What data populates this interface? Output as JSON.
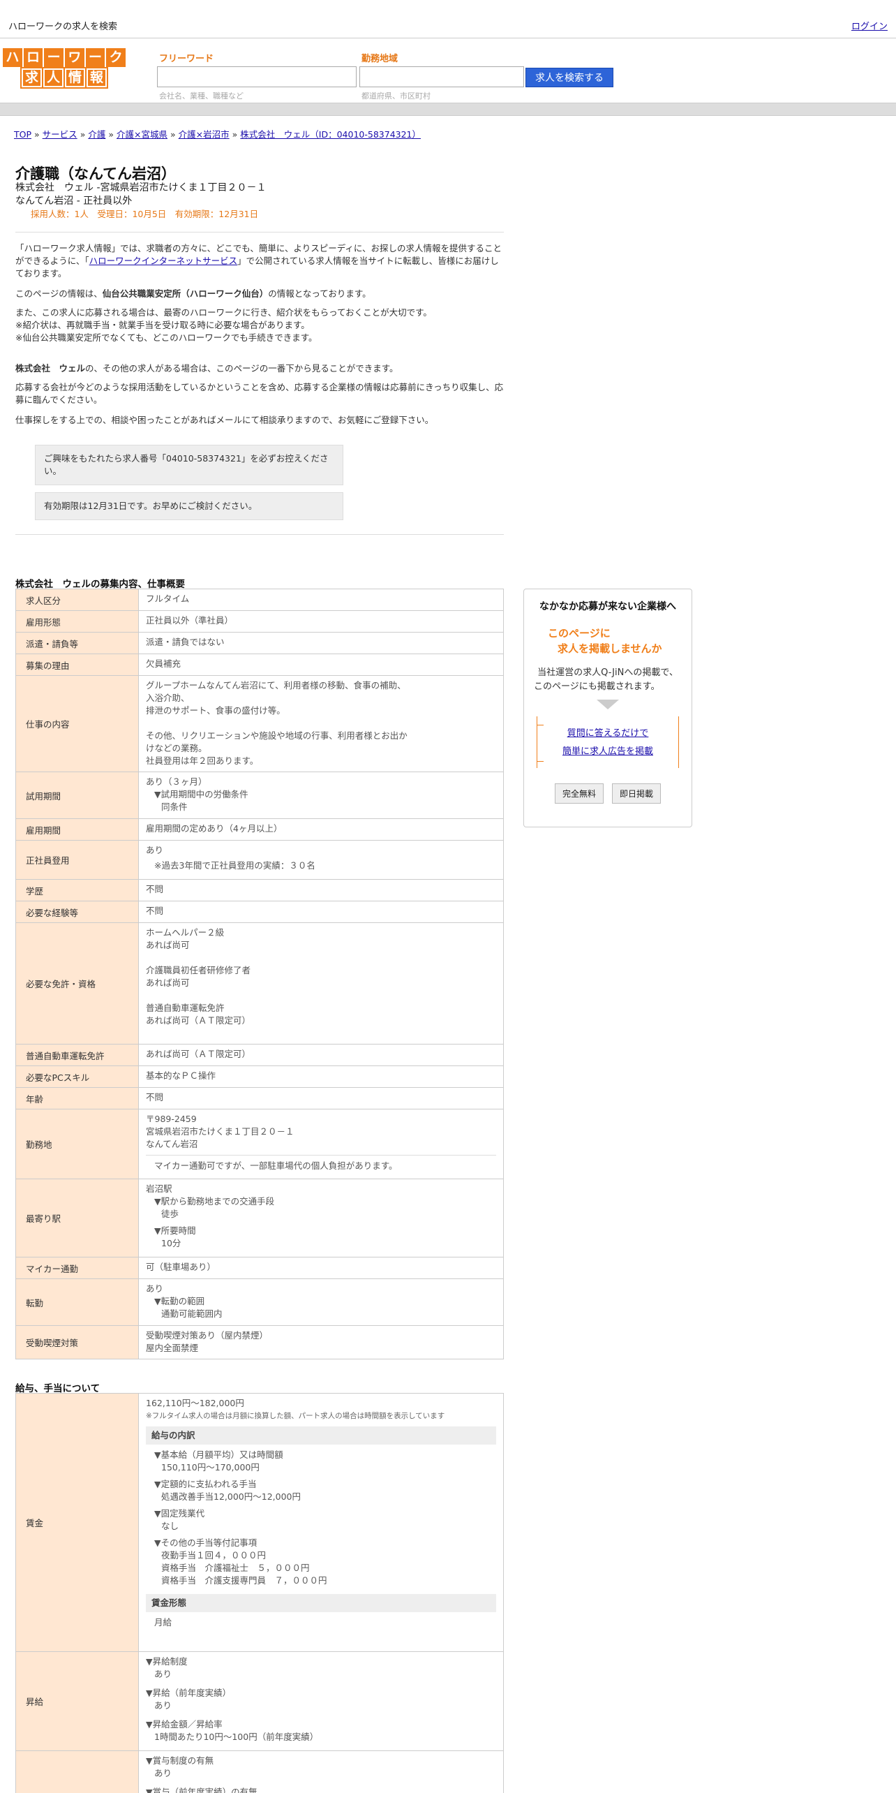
{
  "topbar": {
    "title": "ハローワークの求人を検索",
    "login": "ログイン"
  },
  "logo": {
    "row1": [
      "ハ",
      "ロ",
      "ー",
      "ワ",
      "ー",
      "ク"
    ],
    "row2": [
      "求",
      "人",
      "情",
      "報"
    ]
  },
  "search": {
    "free_label": "フリーワード",
    "free_hint": "会社名、業種、職種など",
    "area_label": "勤務地域",
    "area_hint": "都道府県、市区町村",
    "button": "求人を検索する"
  },
  "breadcrumb": [
    "TOP",
    "サービス",
    "介護",
    "介護×宮城県",
    "介護×岩沼市",
    "株式会社　ウェル（ID：04010-58374321）"
  ],
  "job": {
    "title": "介護職（なんてん岩沼）",
    "company_line": "株式会社　ウェル -宮城県岩沼市たけくま１丁目２０－１",
    "place_line": "なんてん岩沼 - 正社員以外",
    "meta": "採用人数：1人　受理日：10月5日　有効期限：12月31日"
  },
  "intro": {
    "p1a": "「ハローワーク求人情報」では、求職者の方々に、どこでも、簡単に、よりスピーディに、お探しの求人情報を提供することができるように、「",
    "p1link": "ハローワークインターネットサービス",
    "p1b": "」で公開されている求人情報を当サイトに転載し、皆様にお届けしております。",
    "p2a": "このページの情報は、",
    "p2b": "仙台公共職業安定所（ハローワーク仙台）",
    "p2c": "の情報となっております。",
    "p3": [
      "また、この求人に応募される場合は、最寄のハローワークに行き、紹介状をもらっておくことが大切です。",
      "※紹介状は、再就職手当・就業手当を受け取る時に必要な場合があります。",
      "※仙台公共職業安定所でなくても、どこのハローワークでも手続きできます。"
    ],
    "p4a": "株式会社　ウェル",
    "p4b": "の、その他の求人がある場合は、このページの一番下から見ることができます。",
    "p5": "応募する会社が今どのような採用活動をしているかということを含め、応募する企業様の情報は応募前にきっちり収集し、応募に臨んでください。",
    "p6": "仕事探しをする上での、相談や困ったことがあればメールにて相談承りますので、お気軽にご登録下さい。",
    "notice1": "ご興味をもたれたら求人番号「04010-58374321」を必ずお控えください。",
    "notice2": "有効期限は12月31日です。お早めにご検討ください。"
  },
  "section1_title": "株式会社　ウェルの募集内容、仕事概要",
  "rows": {
    "kubun": [
      "求人区分",
      "フルタイム"
    ],
    "koyo": [
      "雇用形態",
      "正社員以外（準社員）"
    ],
    "haken": [
      "派遣・請負等",
      "派遣・請負ではない"
    ],
    "riyu": [
      "募集の理由",
      "欠員補充"
    ],
    "naiyo": [
      "仕事の内容",
      "グループホームなんてん岩沼にて、利用者様の移動、食事の補助、",
      "入浴介助、",
      "排泄のサポート、食事の盛付け等。",
      "その他、リクリエーションや施設や地域の行事、利用者様とお出か",
      "けなどの業務。",
      "社員登用は年２回あります。"
    ],
    "shiyo": [
      "試用期間",
      "あり（３ヶ月）",
      "▼試用期間中の労働条件",
      "同条件"
    ],
    "koyokikan": [
      "雇用期間",
      "雇用期間の定めあり（4ヶ月以上）"
    ],
    "seishain": [
      "正社員登用",
      "あり",
      "※過去3年間で正社員登用の実績：３０名"
    ],
    "gakureki": [
      "学歴",
      "不問"
    ],
    "keiken": [
      "必要な経験等",
      "不問"
    ],
    "menkyo": [
      "必要な免許・資格",
      "ホームヘルパー２級",
      "あれば尚可",
      "介護職員初任者研修修了者",
      "あれば尚可",
      "普通自動車運転免許",
      "あれば尚可（ＡＴ限定可）"
    ],
    "futsu": [
      "普通自動車運転免許",
      "あれば尚可（ＡＴ限定可）"
    ],
    "pc": [
      "必要なPCスキル",
      "基本的なＰＣ操作"
    ],
    "nenrei": [
      "年齢",
      "不問"
    ],
    "kinmuchi": [
      "勤務地",
      "〒989-2459",
      "宮城県岩沼市たけくま１丁目２０－１",
      "なんてん岩沼",
      "マイカー通勤可ですが、一部駐車場代の個人負担があります。"
    ],
    "eki": [
      "最寄り駅",
      "岩沼駅",
      "▼駅から勤務地までの交通手段",
      "徒歩",
      "▼所要時間",
      "10分"
    ],
    "mycar": [
      "マイカー通勤",
      "可（駐車場あり）"
    ],
    "tenkin": [
      "転勤",
      "あり",
      "▼転勤の範囲",
      "通勤可能範囲内"
    ],
    "kitsuen": [
      "受動喫煙対策",
      "受動喫煙対策あり（屋内禁煙）",
      "屋内全面禁煙"
    ]
  },
  "section2_title": "給与、手当について",
  "salary": {
    "label": "賃金",
    "range": "162,110円〜182,000円",
    "note": "※フルタイム求人の場合は月額に換算した額、パート求人の場合は時間額を表示しています",
    "breakdown_title": "給与の内訳",
    "items": [
      [
        "▼基本給（月額平均）又は時間額",
        "150,110円〜170,000円"
      ],
      [
        "▼定額的に支払われる手当",
        "処遇改善手当12,000円〜12,000円"
      ],
      [
        "▼固定残業代",
        "なし"
      ],
      [
        "▼その他の手当等付記事項",
        "夜勤手当１回４，０００円",
        "資格手当　介護福祉士　５，０００円",
        "資格手当　介護支援専門員　７，０００円"
      ]
    ],
    "form_title": "賃金形態",
    "form_value": "月給"
  },
  "raise": {
    "label": "昇給",
    "items": [
      [
        "▼昇給制度",
        "あり"
      ],
      [
        "▼昇給（前年度実績）",
        "あり"
      ],
      [
        "▼昇給金額／昇給率",
        "1時間あたり10円〜100円（前年度実績）"
      ]
    ]
  },
  "bonus": {
    "items": [
      "▼賞与制度の有無",
      "あり",
      "▼賞与（前年度実績）の有無"
    ]
  },
  "ad": {
    "title": "なかなか応募が来ない企業様へ",
    "catch1": "このページに",
    "catch2": "求人を掲載しませんか",
    "desc1": "当社運営の求人Q-JiNへの掲載で、",
    "desc2": "このページにも掲載されます。",
    "link1": "質問に答えるだけで",
    "link2": "簡単に求人広告を掲載",
    "btn1": "完全無料",
    "btn2": "即日掲載"
  }
}
